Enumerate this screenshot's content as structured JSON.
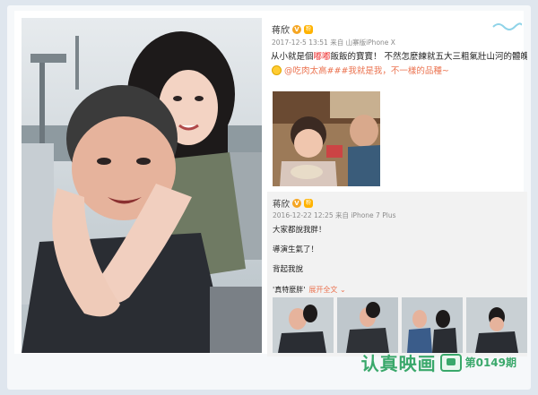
{
  "post": {
    "username": "蒋欣",
    "verified_badge": "V",
    "level_badge": "粉",
    "meta": "2017-12-5 13:51 来自 山寨版iPhone X",
    "line1_prefix": "从小就是個",
    "line1_red": "嘟嘟",
    "line1_suffix": "飯飯的寶寶！ 不然怎麼練就五大三粗氣壯山河的體魄！！",
    "line2_link": "@吃肉太高###我就是我，不一樣的品種~"
  },
  "repost": {
    "username": "蒋欣",
    "meta": "2016-12-22 12:25 来自 iPhone 7 Plus",
    "line1": "大家都說我胖！",
    "line2": "導演生氣了！",
    "line3": "背起我說",
    "tag": "'真特麼胖'",
    "expand": "展开全文 ⌄"
  },
  "footer": {
    "brand": "认真映画",
    "issue": "第0149期"
  },
  "colors": {
    "accent": "#eb7350",
    "brand_green": "#3aa86b",
    "verified": "#f5a623"
  },
  "icons": {
    "verified": "verified-v-icon",
    "tv": "tv-icon"
  }
}
